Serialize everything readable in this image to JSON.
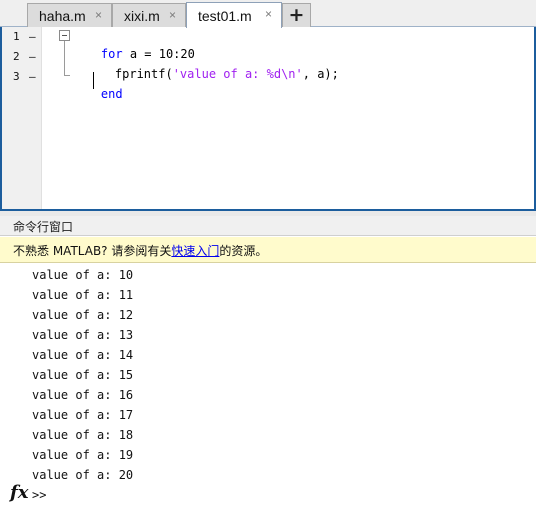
{
  "tabs": [
    {
      "label": "haha.m",
      "active": false
    },
    {
      "label": "xixi.m",
      "active": false
    },
    {
      "label": "test01.m",
      "active": true
    }
  ],
  "tab_close_glyph": "×",
  "new_tab_glyph": "+",
  "editor": {
    "lines": [
      {
        "num": "1",
        "marker": "–"
      },
      {
        "num": "2",
        "marker": "–"
      },
      {
        "num": "3",
        "marker": "–"
      }
    ],
    "code": {
      "l1_kw": "for",
      "l1_rest": " a = 10:20",
      "l2_fn": "fprintf(",
      "l2_str": "'value of a: %d\\n'",
      "l2_rest": ", a);",
      "l3_kw": "end"
    }
  },
  "command_window": {
    "title": "命令行窗口",
    "banner_prefix": "不熟悉 MATLAB? 请参阅有关",
    "banner_link": "快速入门",
    "banner_suffix": "的资源。",
    "output": [
      "value of a: 10",
      "value of a: 11",
      "value of a: 12",
      "value of a: 13",
      "value of a: 14",
      "value of a: 15",
      "value of a: 16",
      "value of a: 17",
      "value of a: 18",
      "value of a: 19",
      "value of a: 20"
    ],
    "fx_symbol": "fx",
    "prompt": ">>"
  },
  "colors": {
    "keyword": "#0000ff",
    "string": "#a020f0",
    "editor_border": "#1c5d9d",
    "banner_bg": "#fffbcc",
    "link": "#0000ee"
  }
}
